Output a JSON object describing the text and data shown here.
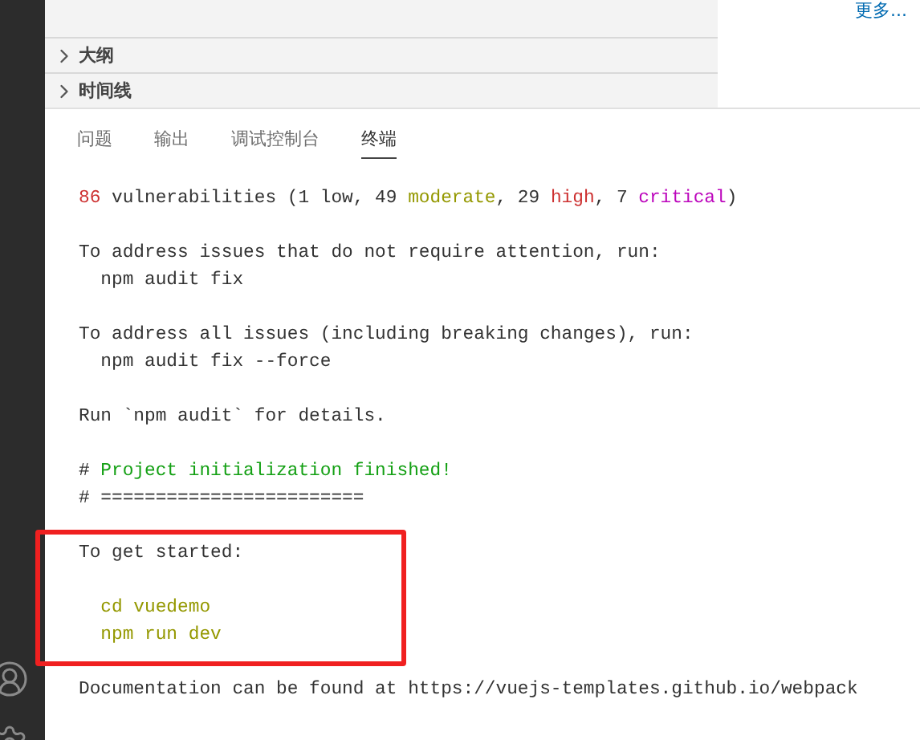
{
  "more_link": "更多...",
  "sections": [
    {
      "label": "大纲",
      "expanded": false
    },
    {
      "label": "时间线",
      "expanded": false
    }
  ],
  "tabs": [
    {
      "label": "问题",
      "selected": false
    },
    {
      "label": "输出",
      "selected": false
    },
    {
      "label": "调试控制台",
      "selected": false
    },
    {
      "label": "终端",
      "selected": true
    }
  ],
  "terminal": {
    "blocks": [
      {
        "highlighted": false,
        "lines": [
          {
            "gap_before": false,
            "segments": [
              {
                "text": "86",
                "kind": "error"
              },
              {
                "text": " vulnerabilities (1 low, 49 ",
                "kind": "plain"
              },
              {
                "text": "moderate",
                "kind": "warning"
              },
              {
                "text": ", 29 ",
                "kind": "plain"
              },
              {
                "text": "high",
                "kind": "error"
              },
              {
                "text": ", 7 ",
                "kind": "plain"
              },
              {
                "text": "critical",
                "kind": "critical"
              },
              {
                "text": ")",
                "kind": "plain"
              }
            ]
          }
        ]
      },
      {
        "highlighted": false,
        "lines": [
          {
            "gap_before": false,
            "segments": [
              {
                "text": "To address issues that do not require attention, run:",
                "kind": "plain"
              }
            ]
          },
          {
            "gap_before": false,
            "segments": [
              {
                "text": "  npm audit fix",
                "kind": "plain"
              }
            ]
          }
        ]
      },
      {
        "highlighted": false,
        "lines": [
          {
            "gap_before": false,
            "segments": [
              {
                "text": "To address all issues (including breaking changes), run:",
                "kind": "plain"
              }
            ]
          },
          {
            "gap_before": false,
            "segments": [
              {
                "text": "  npm audit fix --force",
                "kind": "plain"
              }
            ]
          }
        ]
      },
      {
        "highlighted": false,
        "lines": [
          {
            "gap_before": false,
            "segments": [
              {
                "text": "Run `npm audit` for details.",
                "kind": "plain"
              }
            ]
          }
        ]
      },
      {
        "highlighted": false,
        "lines": [
          {
            "gap_before": false,
            "segments": [
              {
                "text": "# ",
                "kind": "plain"
              },
              {
                "text": "Project initialization finished!",
                "kind": "success"
              }
            ]
          },
          {
            "gap_before": false,
            "segments": [
              {
                "text": "# ========================",
                "kind": "plain"
              }
            ]
          }
        ]
      },
      {
        "highlighted": true,
        "lines": [
          {
            "gap_before": false,
            "segments": [
              {
                "text": "To get started:",
                "kind": "plain"
              }
            ]
          },
          {
            "gap_before": true,
            "segments": [
              {
                "text": "  cd vuedemo",
                "kind": "warning"
              }
            ]
          },
          {
            "gap_before": false,
            "segments": [
              {
                "text": "  npm run dev",
                "kind": "warning"
              }
            ]
          }
        ]
      },
      {
        "highlighted": false,
        "lines": [
          {
            "gap_before": false,
            "segments": [
              {
                "text": "Documentation can be found at https://vuejs-templates.github.io/webpack",
                "kind": "plain"
              }
            ]
          }
        ]
      }
    ]
  }
}
